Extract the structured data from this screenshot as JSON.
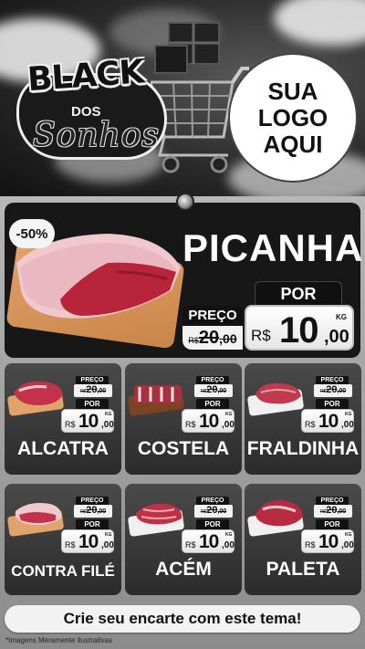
{
  "brand": {
    "line1": "BLACK",
    "line2": "DOS",
    "line3": "Sonhos"
  },
  "logo_placeholder": {
    "line1": "SUA",
    "line2": "LOGO",
    "line3": "AQUI"
  },
  "featured": {
    "discount": "-50%",
    "name": "PICANHA",
    "preco_label": "PREÇO",
    "por_label": "POR",
    "old_price": {
      "currency": "R$",
      "integer": "20",
      "decimals": ",00"
    },
    "new_price": {
      "currency": "R$",
      "integer": "10",
      "decimals": ",00",
      "unit": "KG"
    }
  },
  "products": [
    {
      "name": "ALCATRA",
      "preco_label": "PREÇO",
      "por_label": "POR",
      "old": {
        "currency": "R$",
        "integer": "20",
        "decimals": ",00"
      },
      "new": {
        "currency": "R$",
        "integer": "10",
        "decimals": ",00",
        "unit": "KG"
      }
    },
    {
      "name": "COSTELA",
      "preco_label": "PREÇO",
      "por_label": "POR",
      "old": {
        "currency": "R$",
        "integer": "20",
        "decimals": ",00"
      },
      "new": {
        "currency": "R$",
        "integer": "10",
        "decimals": ",00",
        "unit": "KG"
      }
    },
    {
      "name": "FRALDINHA",
      "preco_label": "PREÇO",
      "por_label": "POR",
      "old": {
        "currency": "R$",
        "integer": "20",
        "decimals": ",00"
      },
      "new": {
        "currency": "R$",
        "integer": "10",
        "decimals": ",00",
        "unit": "KG"
      }
    },
    {
      "name": "CONTRA FILÉ",
      "preco_label": "PREÇO",
      "por_label": "POR",
      "old": {
        "currency": "R$",
        "integer": "20",
        "decimals": ",00"
      },
      "new": {
        "currency": "R$",
        "integer": "10",
        "decimals": ",00",
        "unit": "KG"
      }
    },
    {
      "name": "ACÉM",
      "preco_label": "PREÇO",
      "por_label": "POR",
      "old": {
        "currency": "R$",
        "integer": "20",
        "decimals": ",00"
      },
      "new": {
        "currency": "R$",
        "integer": "10",
        "decimals": ",00",
        "unit": "KG"
      }
    },
    {
      "name": "PALETA",
      "preco_label": "PREÇO",
      "por_label": "POR",
      "old": {
        "currency": "R$",
        "integer": "20",
        "decimals": ",00"
      },
      "new": {
        "currency": "R$",
        "integer": "10",
        "decimals": ",00",
        "unit": "KG"
      }
    }
  ],
  "cta": "Crie seu encarte com este tema!",
  "disclaimer": "*Imagens Meramente Ilustrativas",
  "colors": {
    "card_dark": "#2b2b2b",
    "meat_red": "#b8243a",
    "fat": "#f2d3d6",
    "board": "#e0a36a"
  }
}
